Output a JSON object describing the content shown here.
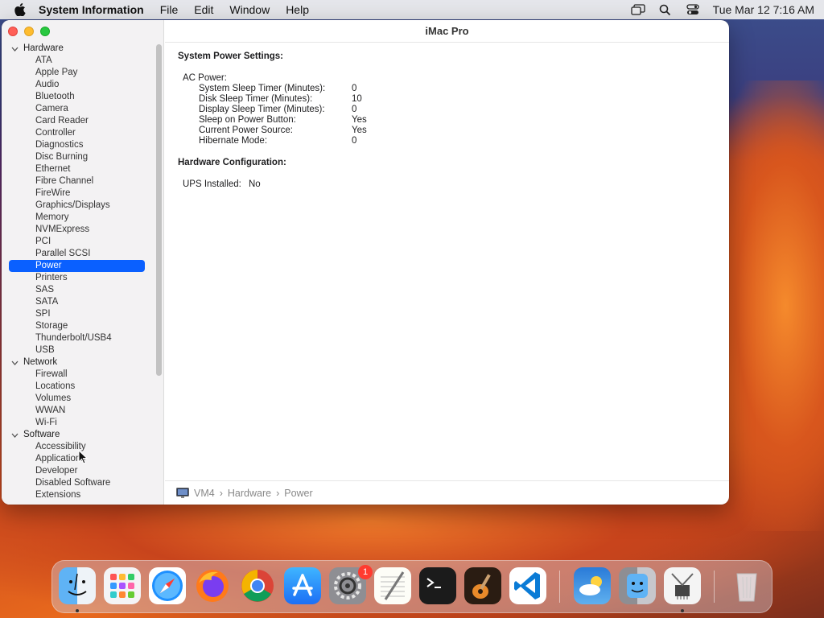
{
  "menubar": {
    "app_name": "System Information",
    "menus": [
      "File",
      "Edit",
      "Window",
      "Help"
    ],
    "clock": "Tue Mar 12  7:16 AM"
  },
  "window": {
    "title": "iMac Pro",
    "breadcrumb": [
      "VM4",
      "Hardware",
      "Power"
    ]
  },
  "sidebar": {
    "groups": [
      {
        "label": "Hardware",
        "items": [
          "ATA",
          "Apple Pay",
          "Audio",
          "Bluetooth",
          "Camera",
          "Card Reader",
          "Controller",
          "Diagnostics",
          "Disc Burning",
          "Ethernet",
          "Fibre Channel",
          "FireWire",
          "Graphics/Displays",
          "Memory",
          "NVMExpress",
          "PCI",
          "Parallel SCSI",
          "Power",
          "Printers",
          "SAS",
          "SATA",
          "SPI",
          "Storage",
          "Thunderbolt/USB4",
          "USB"
        ]
      },
      {
        "label": "Network",
        "items": [
          "Firewall",
          "Locations",
          "Volumes",
          "WWAN",
          "Wi-Fi"
        ]
      },
      {
        "label": "Software",
        "items": [
          "Accessibility",
          "Applications",
          "Developer",
          "Disabled Software",
          "Extensions"
        ]
      }
    ],
    "selected": "Power"
  },
  "content": {
    "power_settings_title": "System Power Settings:",
    "ac_power_label": "AC Power:",
    "ac_settings": [
      {
        "key": "System Sleep Timer (Minutes):",
        "value": "0"
      },
      {
        "key": "Disk Sleep Timer (Minutes):",
        "value": "10"
      },
      {
        "key": "Display Sleep Timer (Minutes):",
        "value": "0"
      },
      {
        "key": "Sleep on Power Button:",
        "value": "Yes"
      },
      {
        "key": "Current Power Source:",
        "value": "Yes"
      },
      {
        "key": "Hibernate Mode:",
        "value": "0"
      }
    ],
    "hardware_config_title": "Hardware Configuration:",
    "ups_key": "UPS Installed:",
    "ups_value": "No"
  },
  "dock": {
    "apps": [
      "Finder",
      "Launchpad",
      "Safari",
      "Firefox",
      "Chrome",
      "App Store",
      "System Settings",
      "TextEdit",
      "Terminal",
      "GarageBand",
      "Visual Studio Code",
      "Weather",
      "Migration Assistant",
      "System Information",
      "Trash"
    ],
    "settings_badge": "1",
    "colors": {
      "accent": "#0a60ff",
      "badge": "#ff3b30"
    }
  }
}
